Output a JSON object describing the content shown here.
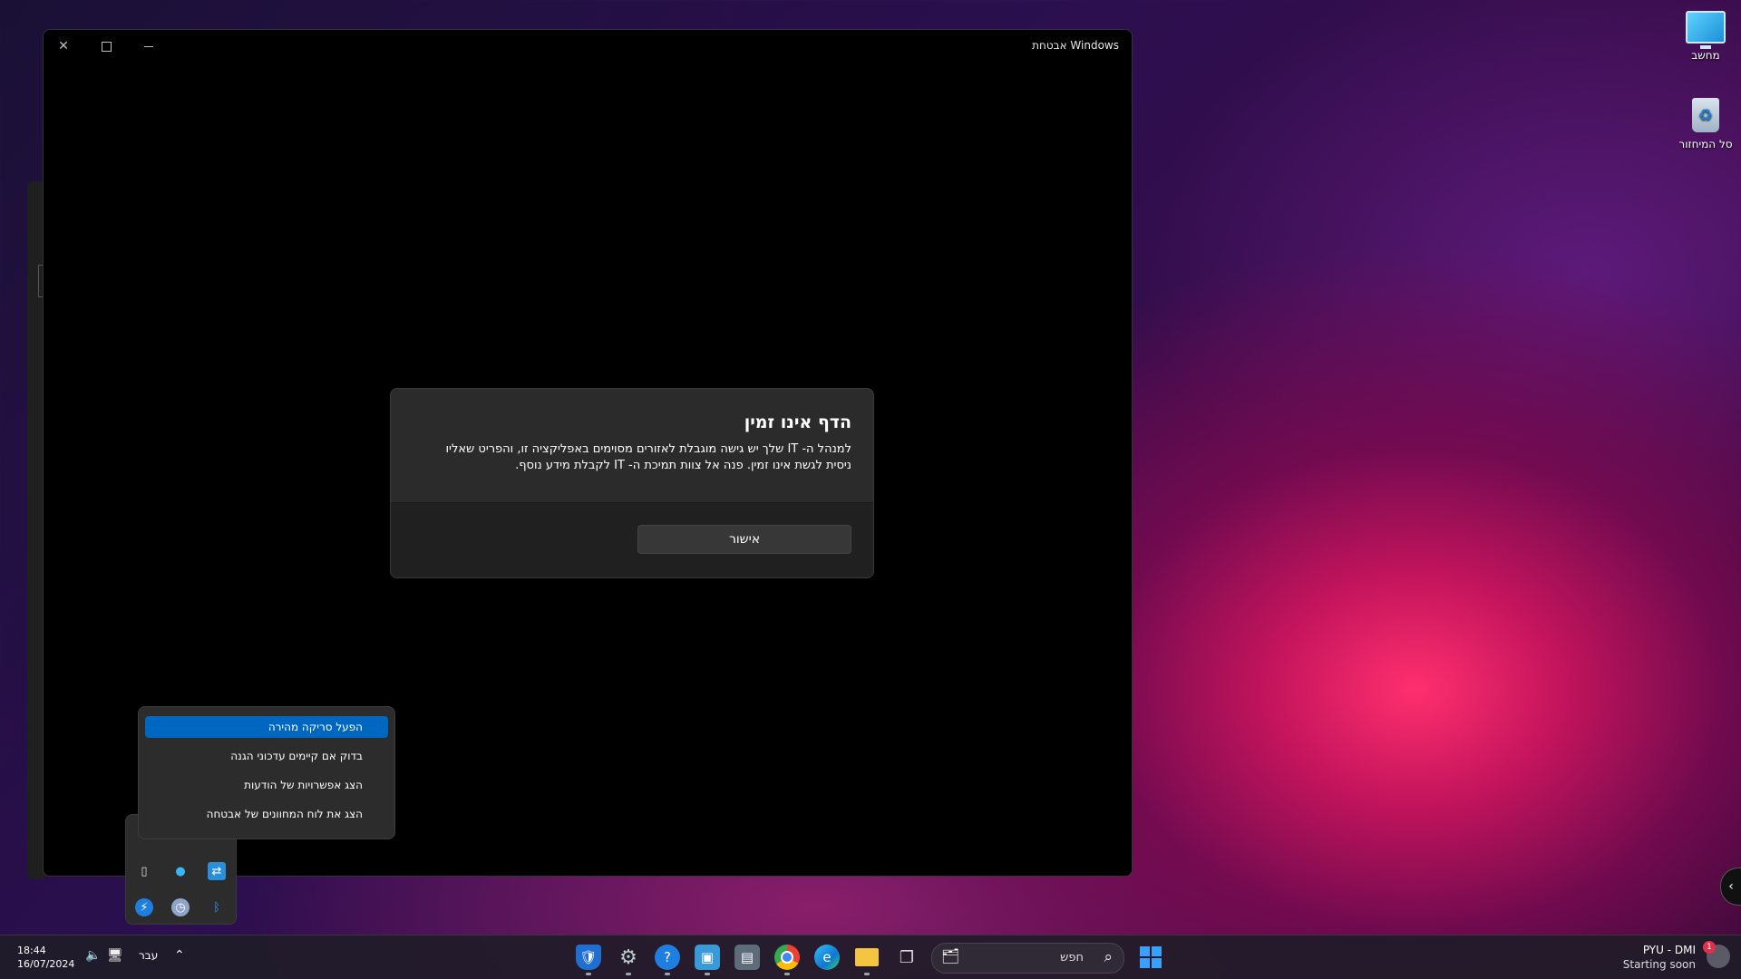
{
  "window": {
    "title": "אבטחת Windows"
  },
  "dialog": {
    "title": "הדף אינו זמין",
    "message_line1": "למנהל ה- IT שלך יש גישה מוגבלת לאזורים מסוימים באפליקציה זו, והפריט שאליו",
    "message_line2": "ניסית לגשת אינו זמין. פנה אל צוות תמיכת ה- IT לקבלת מידע נוסף.",
    "ok_label": "אישור"
  },
  "context_menu": {
    "items": [
      {
        "label": "הפעל סריקה מהירה",
        "active": true
      },
      {
        "label": "בדוק אם קיימים עדכוני הגנה",
        "active": false
      },
      {
        "label": "הצג אפשרויות של הודעות",
        "active": false
      },
      {
        "label": "הצג את לוח המחוונים של אבטחה",
        "active": false
      }
    ]
  },
  "desktop": {
    "icons": [
      {
        "label": "מחשב",
        "icon": "computer-icon"
      },
      {
        "label": "סל המיחזור",
        "icon": "recycle-bin-icon"
      }
    ]
  },
  "taskbar": {
    "time": "18:44",
    "date": "16/07/2024",
    "language": "עבר",
    "search_placeholder": "חפש",
    "weather_title": "PYU - DMI",
    "weather_subtitle": "Starting soon",
    "notification_count": "1",
    "accent": "#0067c0"
  }
}
